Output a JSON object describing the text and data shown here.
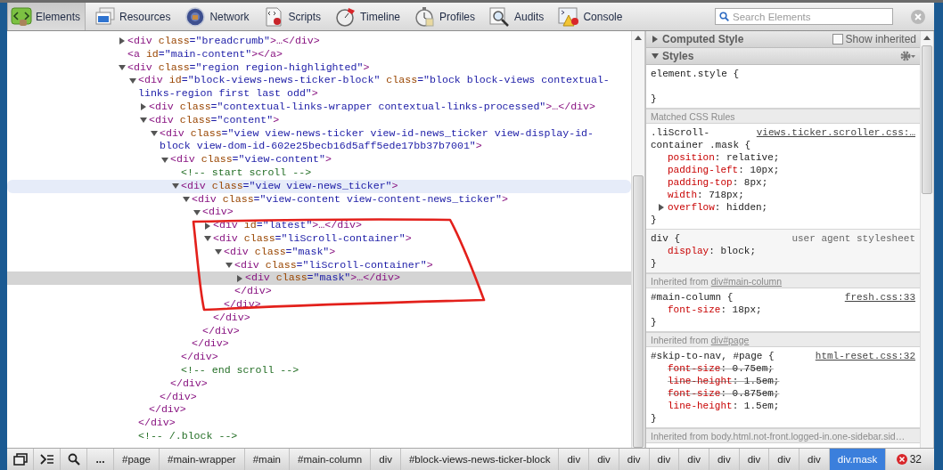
{
  "toolbar": {
    "tabs": [
      {
        "label": "Elements",
        "selected": true
      },
      {
        "label": "Resources",
        "selected": false
      },
      {
        "label": "Network",
        "selected": false
      },
      {
        "label": "Scripts",
        "selected": false
      },
      {
        "label": "Timeline",
        "selected": false
      },
      {
        "label": "Profiles",
        "selected": false
      },
      {
        "label": "Audits",
        "selected": false
      },
      {
        "label": "Console",
        "selected": false
      }
    ],
    "search": {
      "placeholder": "Search Elements"
    }
  },
  "tree": [
    {
      "kind": "element",
      "text": "<div class=\"breadcrumb\">…</div>",
      "expanded": false,
      "selected": false,
      "hovered": false
    },
    {
      "kind": "leaf",
      "text": "<a id=\"main-content\"></a>",
      "selected": false,
      "hovered": false
    },
    {
      "kind": "element",
      "text": "<div class=\"region region-highlighted\">",
      "expanded": true,
      "selected": false,
      "hovered": false,
      "children": [
        {
          "kind": "element",
          "text": "<div id=\"block-views-news-ticker-block\" class=\"block block-views contextual-links-region first last odd\">",
          "expanded": true,
          "selected": false,
          "hovered": false,
          "close": "</div>",
          "children": [
            {
              "kind": "element",
              "text": "<div class=\"contextual-links-wrapper contextual-links-processed\">…</div>",
              "expanded": false,
              "selected": false,
              "hovered": false
            },
            {
              "kind": "element",
              "text": "<div class=\"content\">",
              "expanded": true,
              "selected": false,
              "hovered": false,
              "close": "</div>",
              "children": [
                {
                  "kind": "element",
                  "text": "<div class=\"view view-news-ticker view-id-news_ticker view-display-id-block view-dom-id-602e25becb16d5aff5ede17bb37b7001\">",
                  "expanded": true,
                  "selected": false,
                  "hovered": false,
                  "close": "</div>",
                  "children": [
                    {
                      "kind": "element",
                      "text": "<div class=\"view-content\">",
                      "expanded": true,
                      "selected": false,
                      "hovered": false,
                      "close": "</div>",
                      "children": [
                        {
                          "kind": "comment",
                          "text": "<!-- start scroll -->",
                          "selected": false,
                          "hovered": false
                        },
                        {
                          "kind": "element",
                          "text": "<div class=\"view view-news_ticker\">",
                          "expanded": true,
                          "selected": false,
                          "hovered": true,
                          "close": "</div>",
                          "children": [
                            {
                              "kind": "element",
                              "text": "<div class=\"view-content view-content-news_ticker\">",
                              "expanded": true,
                              "selected": false,
                              "hovered": false,
                              "close": "</div>",
                              "children": [
                                {
                                  "kind": "element",
                                  "text": "<div>",
                                  "expanded": true,
                                  "selected": false,
                                  "hovered": false,
                                  "close": "</div>",
                                  "children": [
                                    {
                                      "kind": "element",
                                      "text": "<div id=\"latest\">…</div>",
                                      "expanded": false,
                                      "selected": false,
                                      "hovered": false
                                    },
                                    {
                                      "kind": "element",
                                      "text": "<div class=\"liScroll-container\">",
                                      "expanded": true,
                                      "selected": false,
                                      "hovered": false,
                                      "close": "</div>",
                                      "children": [
                                        {
                                          "kind": "element",
                                          "text": "<div class=\"mask\">",
                                          "expanded": true,
                                          "selected": false,
                                          "hovered": false,
                                          "close": "</div>",
                                          "children": [
                                            {
                                              "kind": "element",
                                              "text": "<div class=\"liScroll-container\">",
                                              "expanded": true,
                                              "selected": false,
                                              "hovered": false,
                                              "close": "</div>",
                                              "children": [
                                                {
                                                  "kind": "element",
                                                  "text": "<div class=\"mask\">…</div>",
                                                  "expanded": false,
                                                  "selected": true,
                                                  "hovered": false
                                                }
                                              ]
                                            }
                                          ]
                                        }
                                      ]
                                    }
                                  ]
                                }
                              ]
                            }
                          ]
                        },
                        {
                          "kind": "comment",
                          "text": "<!-- end scroll -->",
                          "selected": false,
                          "hovered": false
                        }
                      ]
                    }
                  ]
                }
              ]
            }
          ]
        },
        {
          "kind": "comment",
          "text": "<!-- /.block -->",
          "selected": false,
          "hovered": false
        }
      ]
    }
  ],
  "annotation": {
    "kind": "outline"
  },
  "sidebar": {
    "panes": [
      {
        "title": "Computed Style",
        "expanded": false,
        "checkbox": {
          "label": "Show inherited",
          "checked": false
        }
      },
      {
        "title": "Styles",
        "expanded": true
      }
    ],
    "sections": [
      {
        "kind": "rule",
        "selector": "element.style {",
        "close": "}"
      },
      {
        "kind": "header",
        "text": "Matched CSS Rules"
      },
      {
        "kind": "rule",
        "selector": ".liScroll-container .mask {",
        "source": "views.ticker.scroller.css:…",
        "source_link": true,
        "close": "}",
        "properties": [
          {
            "text": "position: relative;",
            "overridden": false,
            "expandable": false
          },
          {
            "text": "padding-left: 10px;",
            "overridden": false,
            "expandable": false
          },
          {
            "text": "padding-top: 8px;",
            "overridden": false,
            "expandable": false
          },
          {
            "text": "width: 718px;",
            "overridden": false,
            "expandable": false
          },
          {
            "text": "overflow: hidden;",
            "overridden": false,
            "expandable": true
          }
        ]
      },
      {
        "kind": "rule",
        "selector": "div {",
        "source": "user agent stylesheet",
        "source_link": false,
        "close": "}",
        "properties": [
          {
            "text": "display: block;",
            "overridden": false,
            "expandable": false
          }
        ]
      },
      {
        "kind": "header",
        "text": "Inherited from ",
        "link": "div#main-column"
      },
      {
        "kind": "rule",
        "selector": "#main-column {",
        "source": "fresh.css:33",
        "source_link": true,
        "close": "}",
        "properties": [
          {
            "text": "font-size: 18px;",
            "overridden": false,
            "expandable": false
          }
        ]
      },
      {
        "kind": "header",
        "text": "Inherited from ",
        "link": "div#page"
      },
      {
        "kind": "rule",
        "selector": "#skip-to-nav, #page {",
        "source": "html-reset.css:32",
        "source_link": true,
        "close": "}",
        "properties": [
          {
            "text": "font-size: 0.75em;",
            "overridden": true,
            "expandable": false
          },
          {
            "text": "line-height: 1.5em;",
            "overridden": true,
            "expandable": false
          },
          {
            "text": "font-size: 0.875em;",
            "overridden": true,
            "expandable": false
          },
          {
            "text": "line-height: 1.5em;",
            "overridden": false,
            "expandable": false
          }
        ]
      },
      {
        "kind": "header",
        "text": "Inherited from body.html.not-front.logged-in.one-sidebar.sid…"
      }
    ]
  },
  "status_bar": {
    "more": "...",
    "breadcrumbs": [
      {
        "label": "#page",
        "selected": false
      },
      {
        "label": "#main-wrapper",
        "selected": false
      },
      {
        "label": "#main",
        "selected": false
      },
      {
        "label": "#main-column",
        "selected": false
      },
      {
        "label": "div",
        "selected": false
      },
      {
        "label": "#block-views-news-ticker-block",
        "selected": false
      },
      {
        "label": "div",
        "selected": false
      },
      {
        "label": "div",
        "selected": false
      },
      {
        "label": "div",
        "selected": false
      },
      {
        "label": "div",
        "selected": false
      },
      {
        "label": "div",
        "selected": false
      },
      {
        "label": "div",
        "selected": false
      },
      {
        "label": "div",
        "selected": false
      },
      {
        "label": "div",
        "selected": false
      },
      {
        "label": "div",
        "selected": false
      },
      {
        "label": "div.mask",
        "selected": true
      }
    ],
    "errors": "32"
  }
}
